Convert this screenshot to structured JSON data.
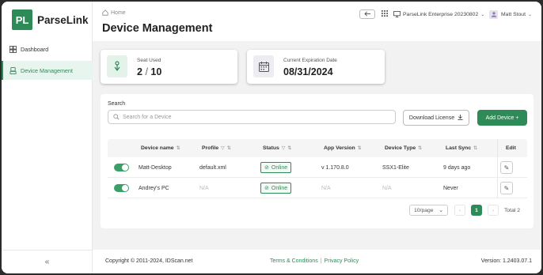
{
  "brand": {
    "mark": "PL",
    "name": "ParseLink"
  },
  "sidebar": {
    "items": [
      {
        "label": "Dashboard",
        "icon": "dashboard-icon"
      },
      {
        "label": "Device Management",
        "icon": "device-icon",
        "active": true
      }
    ],
    "collapse_label": "«"
  },
  "header": {
    "breadcrumb": "Home",
    "title": "Device Management",
    "workspace": "ParseLink Enterprise 20230802",
    "user": "Matt Stout"
  },
  "cards": [
    {
      "label": "Seat Used",
      "value_used": "2",
      "value_sep": "/",
      "value_total": "10",
      "icon": "seat-icon"
    },
    {
      "label": "Current Expiration Date",
      "value": "08/31/2024",
      "icon": "calendar-icon"
    }
  ],
  "search": {
    "label": "Search",
    "placeholder": "Search for a Device"
  },
  "buttons": {
    "download": "Download License",
    "add": "Add Device +"
  },
  "table": {
    "headers": {
      "name": "Device name",
      "profile": "Profile",
      "status": "Status",
      "app_version": "App Version",
      "device_type": "Device Type",
      "last_sync": "Last Sync",
      "edit": "Edit"
    },
    "rows": [
      {
        "enabled": true,
        "name": "Matt-Desktop",
        "profile": "default.xml",
        "status": "Online",
        "app_version": "v 1.170.8.0",
        "device_type": "SSX1-Elite",
        "last_sync": "9 days ago"
      },
      {
        "enabled": true,
        "name": "Andrey's PC",
        "profile": "N/A",
        "status": "Online",
        "app_version": "N/A",
        "device_type": "N/A",
        "last_sync": "Never"
      }
    ]
  },
  "pagination": {
    "page_size": "10/page",
    "current_page": "1",
    "total": "Total 2"
  },
  "footer": {
    "copyright": "Copyright © 2011-2024, IDScan.net",
    "terms": "Terms & Conditions",
    "divider": "|",
    "privacy": "Privacy Policy",
    "version": "Version: 1.2403.07.1"
  },
  "colors": {
    "accent": "#2e8b57",
    "accent_light": "#e8f4ee"
  }
}
